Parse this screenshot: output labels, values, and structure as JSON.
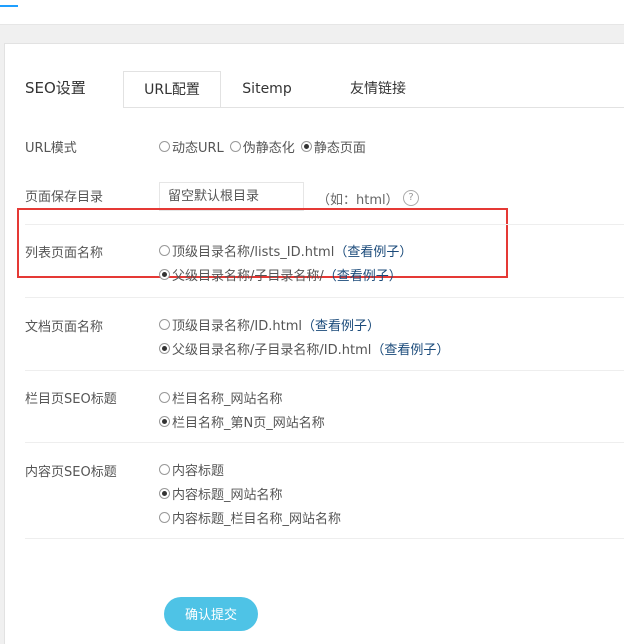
{
  "page": {
    "title": "SEO设置",
    "tabs": [
      "URL配置",
      "Sitemp",
      "友情链接"
    ],
    "active_tab": "URL配置"
  },
  "url_mode": {
    "label": "URL模式",
    "options": [
      {
        "label": "动态URL",
        "selected": false
      },
      {
        "label": "伪静态化",
        "selected": false
      },
      {
        "label": "静态页面",
        "selected": true
      }
    ]
  },
  "save_dir": {
    "label": "页面保存目录",
    "placeholder": "留空默认根目录",
    "hint": "（如：html）",
    "help_icon": "question-icon"
  },
  "list_page_name": {
    "label": "列表页面名称",
    "options": [
      {
        "label": "顶级目录名称/lists_ID.html",
        "link": "（查看例子）",
        "selected": false
      },
      {
        "label": "父级目录名称/子目录名称/",
        "link": "（查看例子）",
        "selected": true
      }
    ]
  },
  "doc_page_name": {
    "label": "文档页面名称",
    "options": [
      {
        "label": "顶级目录名称/ID.html",
        "link": "（查看例子）",
        "selected": false
      },
      {
        "label": "父级目录名称/子目录名称/ID.html",
        "link": "（查看例子）",
        "selected": true
      }
    ]
  },
  "column_seo_title": {
    "label": "栏目页SEO标题",
    "options": [
      {
        "label": "栏目名称_网站名称",
        "selected": false
      },
      {
        "label": "栏目名称_第N页_网站名称",
        "selected": true
      }
    ]
  },
  "content_seo_title": {
    "label": "内容页SEO标题",
    "options": [
      {
        "label": "内容标题",
        "selected": false
      },
      {
        "label": "内容标题_网站名称",
        "selected": true
      },
      {
        "label": "内容标题_栏目名称_网站名称",
        "selected": false
      }
    ]
  },
  "submit": {
    "label": "确认提交"
  },
  "colors": {
    "accent": "#4ec3e6",
    "highlight": "#e53935",
    "link": "#1a4a7a"
  }
}
